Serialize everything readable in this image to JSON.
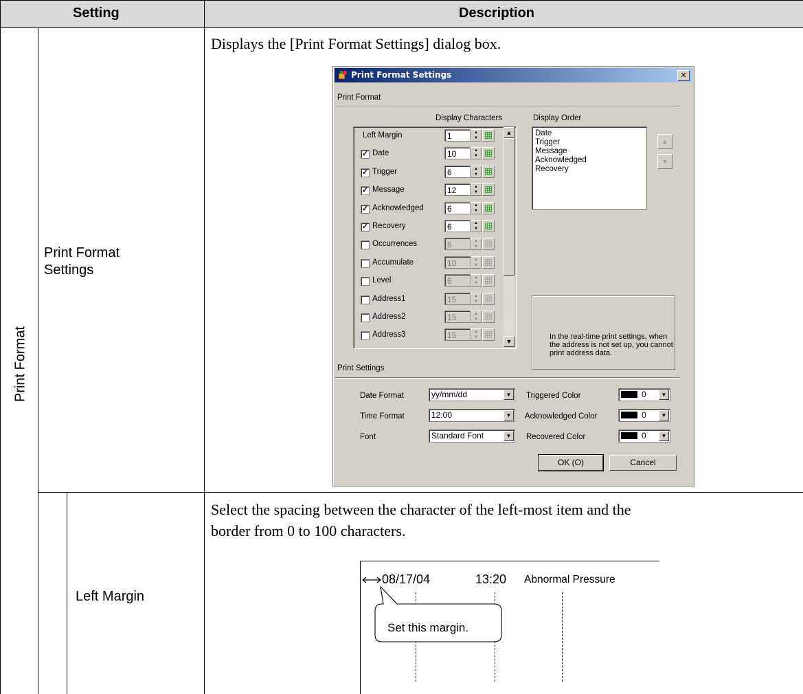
{
  "table": {
    "header_setting": "Setting",
    "header_description": "Description",
    "category": "Print Format",
    "rows": [
      {
        "label": "Print Format\nSettings",
        "description": "Displays the [Print Format Settings] dialog box."
      },
      {
        "label": "Left Margin",
        "description": "Select the spacing between the character of the left-most item and the border from 0 to 100 characters."
      }
    ]
  },
  "dialog": {
    "title": "Print Format Settings",
    "close": "✕",
    "print_format_group": "Print Format",
    "col_display_characters": "Display Characters",
    "col_display_order": "Display Order",
    "left_margin_label": "Left Margin",
    "items": [
      {
        "label": "Left Margin",
        "value": "1",
        "checked": null,
        "enabled": true
      },
      {
        "label": "Date",
        "value": "10",
        "checked": true,
        "enabled": true
      },
      {
        "label": "Trigger",
        "value": "6",
        "checked": true,
        "enabled": true
      },
      {
        "label": "Message",
        "value": "12",
        "checked": true,
        "enabled": true
      },
      {
        "label": "Acknowledged",
        "value": "6",
        "checked": true,
        "enabled": true
      },
      {
        "label": "Recovery",
        "value": "6",
        "checked": true,
        "enabled": true
      },
      {
        "label": "Occurrences",
        "value": "6",
        "checked": false,
        "enabled": false
      },
      {
        "label": "Accumulate",
        "value": "10",
        "checked": false,
        "enabled": false
      },
      {
        "label": "Level",
        "value": "6",
        "checked": false,
        "enabled": false
      },
      {
        "label": "Address1",
        "value": "15",
        "checked": false,
        "enabled": false
      },
      {
        "label": "Address2",
        "value": "15",
        "checked": false,
        "enabled": false
      },
      {
        "label": "Address3",
        "value": "15",
        "checked": false,
        "enabled": false
      }
    ],
    "display_order": [
      "Date",
      "Trigger",
      "Message",
      "Acknowledged",
      "Recovery"
    ],
    "note": "In the real-time print settings, when the address is not set up, you cannot print address data.",
    "print_settings_group": "Print Settings",
    "date_format_label": "Date Format",
    "date_format_value": "yy/mm/dd",
    "time_format_label": "Time Format",
    "time_format_value": "12:00",
    "font_label": "Font",
    "font_value": "Standard Font",
    "triggered_color_label": "Triggered Color",
    "acknowledged_color_label": "Acknowledged Color",
    "recovered_color_label": "Recovered Color",
    "color_value": "0",
    "ok_label": "OK (O)",
    "cancel_label": "Cancel"
  },
  "illustration": {
    "date": "08/17/04",
    "time": "13:20",
    "message": "Abnormal Pressure",
    "callout": "Set this margin."
  },
  "colors": {
    "header_bg": "#d9d9d9",
    "dialog_bg": "#d4d0c8",
    "title_start": "#0a246a",
    "title_end": "#a6caf0"
  }
}
